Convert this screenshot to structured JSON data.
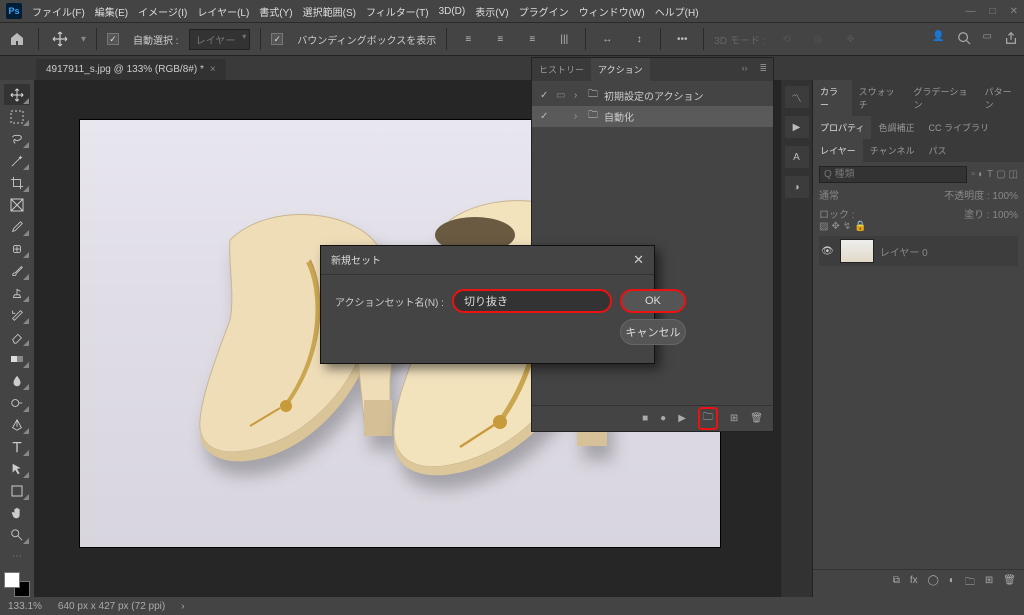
{
  "menu": {
    "items": [
      "ファイル(F)",
      "編集(E)",
      "イメージ(I)",
      "レイヤー(L)",
      "書式(Y)",
      "選択範囲(S)",
      "フィルター(T)",
      "3D(D)",
      "表示(V)",
      "プラグイン",
      "ウィンドウ(W)",
      "ヘルプ(H)"
    ]
  },
  "options": {
    "auto_select_chk": true,
    "auto_select_label": "自動選択 :",
    "auto_select_target": "レイヤー",
    "bbox_chk": true,
    "bbox_label": "バウンディングボックスを表示",
    "mode3d_label": "3D モード :"
  },
  "doc_tab": {
    "title": "4917911_s.jpg @ 133% (RGB/8#) *"
  },
  "actions_panel": {
    "tabs": [
      "ヒストリー",
      "アクション"
    ],
    "active_tab": 1,
    "items": [
      {
        "label": "初期設定のアクション",
        "checked": true
      },
      {
        "label": "自動化",
        "checked": true,
        "selected": true
      }
    ]
  },
  "right": {
    "group1": [
      "カラー",
      "スウォッチ",
      "グラデーション",
      "パターン"
    ],
    "group2": [
      "プロパティ",
      "色調補正",
      "CC ライブラリ"
    ],
    "layers_tabs": [
      "レイヤー",
      "チャンネル",
      "パス"
    ],
    "search_placeholder": "Q 種類",
    "blend_mode": "通常",
    "opacity_label": "不透明度 :",
    "opacity_value": "100%",
    "lock_label": "ロック :",
    "fill_label": "塗り :",
    "fill_value": "100%",
    "layer0_name": "レイヤー 0"
  },
  "dialog": {
    "title": "新規セット",
    "field_label": "アクションセット名(N) :",
    "field_value": "切り抜き",
    "ok": "OK",
    "cancel": "キャンセル"
  },
  "status": {
    "zoom": "133.1%",
    "info": "640 px x 427 px (72 ppi)"
  }
}
